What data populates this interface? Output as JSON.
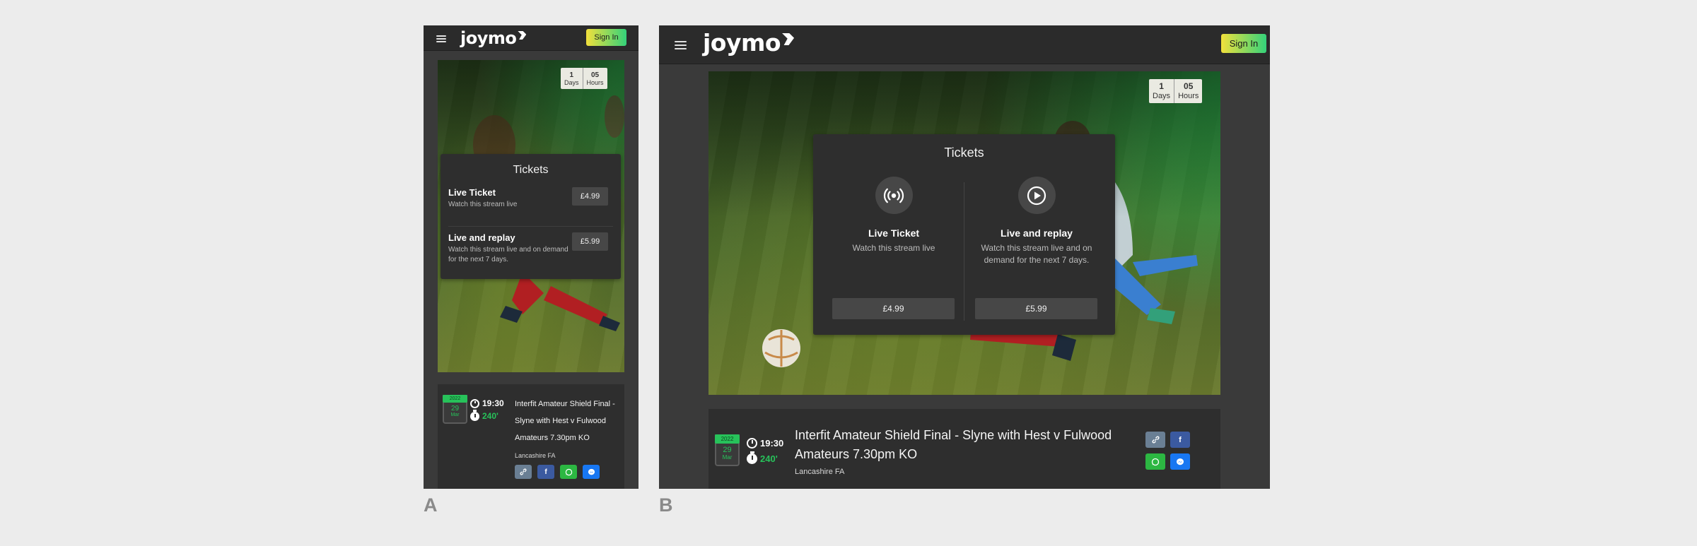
{
  "brand": {
    "logo_text": "joymo",
    "signin_label": "Sign In"
  },
  "countdown": {
    "days_value": "1",
    "days_label": "Days",
    "hours_value": "05",
    "hours_label": "Hours"
  },
  "tickets": {
    "title": "Tickets",
    "options": [
      {
        "name": "Live Ticket",
        "description": "Watch this stream live",
        "price": "£4.99",
        "icon": "broadcast-icon"
      },
      {
        "name": "Live and replay",
        "description": "Watch this stream live and on demand for the next 7 days.",
        "price": "£5.99",
        "icon": "play-icon"
      }
    ]
  },
  "event": {
    "year": "2022",
    "day": "29",
    "month": "Mar",
    "time": "19:30",
    "duration": "240'",
    "title": "Interfit Amateur Shield Final - Slyne with Hest v Fulwood Amateurs 7.30pm KO",
    "organiser": "Lancashire FA",
    "share_icons": [
      "link-icon",
      "facebook-icon",
      "whatsapp-icon",
      "messenger-icon"
    ]
  },
  "panels": {
    "a": "A",
    "b": "B"
  },
  "colors": {
    "accent_green": "#27c25a",
    "signin_gradient_start": "#f2e03c",
    "signin_gradient_end": "#34d27a",
    "panel_bg": "#2e2e2e",
    "frame_bg": "#3a3a3a"
  }
}
